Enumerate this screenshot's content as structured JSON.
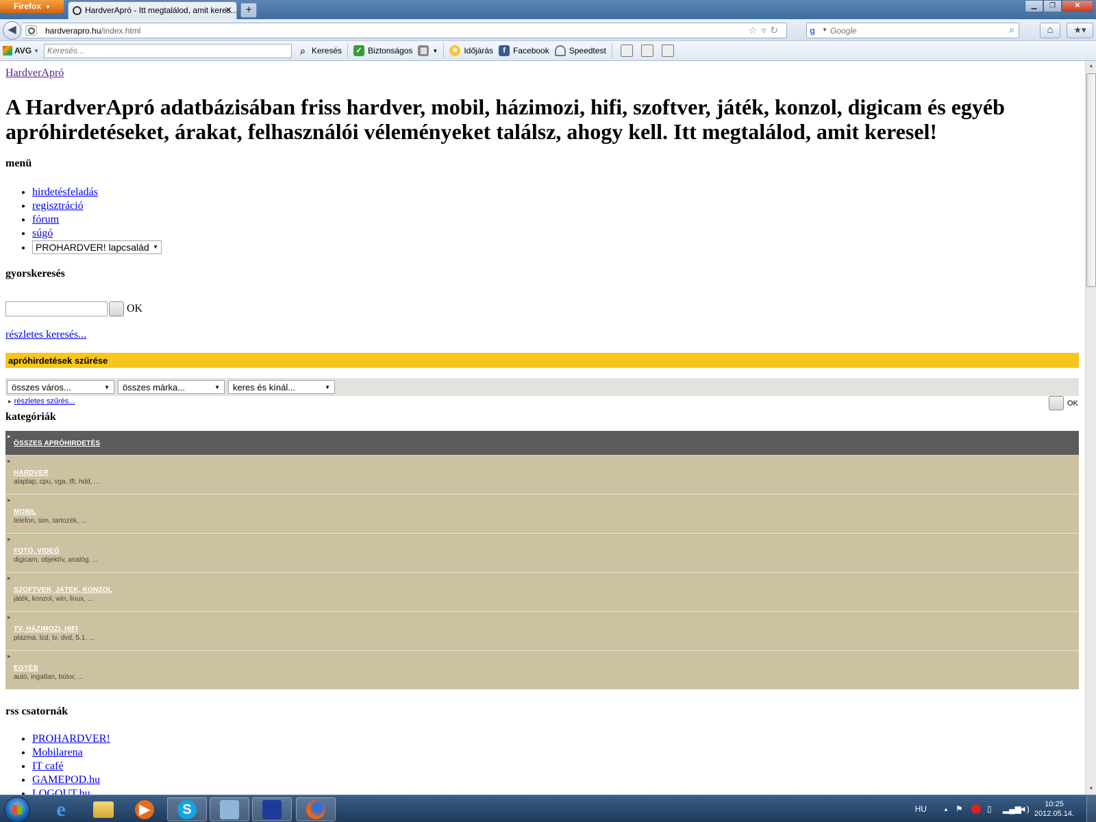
{
  "browser": {
    "app_button": "Firefox",
    "tab_title": "HardverApró - Itt megtalálod, amit keres...",
    "new_tab": "+",
    "url_domain": "hardverapro.hu",
    "url_path": "/index.html",
    "search_placeholder": "Google",
    "window_controls": {
      "minimize": "▁",
      "maximize": "❐",
      "close": "✕"
    }
  },
  "avg_toolbar": {
    "logo": "AVG",
    "search_placeholder": "Keresés...",
    "items": [
      "Keresés",
      "Biztonságos",
      "Időjárás",
      "Facebook",
      "Speedtest"
    ]
  },
  "page": {
    "site_link": "HardverApró",
    "headline": "A HardverApró adatbázisában friss hardver, mobil, házimozi, hifi, szoftver, játék, konzol, digicam és egyéb apróhirdetéseket, árakat, felhasználói véleményeket találsz, ahogy kell. Itt megtalálod, amit keresel!",
    "menu_heading": "menü",
    "menu_items": [
      "hirdetésfeladás",
      "regisztráció",
      "fórum",
      "súgó"
    ],
    "menu_select": "PROHARDVER! lapcsalád",
    "quicksearch_heading": "gyorskeresés",
    "quicksearch_ok": "OK",
    "detailed_search": "részletes keresés...",
    "filter_heading": "apróhirdetések szűrése",
    "filters": [
      "összes város...",
      "összes márka...",
      "keres és kínál..."
    ],
    "detailed_filter": "részletes szűrés...",
    "filter_ok": "OK",
    "categories_heading": "kategóriák",
    "categories": [
      {
        "name": "ÖSSZES APRÓHIRDETÉS",
        "desc": ""
      },
      {
        "name": "HARDVER",
        "desc": "alaplap, cpu, vga, tft, hdd, ..."
      },
      {
        "name": "MOBIL",
        "desc": "telefon, sim, tartozék, ..."
      },
      {
        "name": "FOTÓ, VIDEÓ",
        "desc": "digicam, objektív, analóg, ..."
      },
      {
        "name": "SZOFTVER, JÁTÉK, KONZOL",
        "desc": "játék, konzol, win, linux, ..."
      },
      {
        "name": "TV, HÁZIMOZI, HIFI",
        "desc": "plazma, lcd, tv, dvd, 5.1, ..."
      },
      {
        "name": "EGYÉB",
        "desc": "autó, ingatlan, bútor, ..."
      }
    ],
    "rss_heading": "rss csatornák",
    "rss_items": [
      "PROHARDVER!",
      "Mobilarena",
      "IT café",
      "GAMEPOD.hu",
      "LOGOUT.hu"
    ]
  },
  "taskbar": {
    "language": "HU",
    "time": "10:25",
    "date": "2012.05.14."
  },
  "colors": {
    "filter_bar": "#f8c61a",
    "category_bg": "#ccc1a1",
    "category_all_bg": "#5c5c5c"
  }
}
